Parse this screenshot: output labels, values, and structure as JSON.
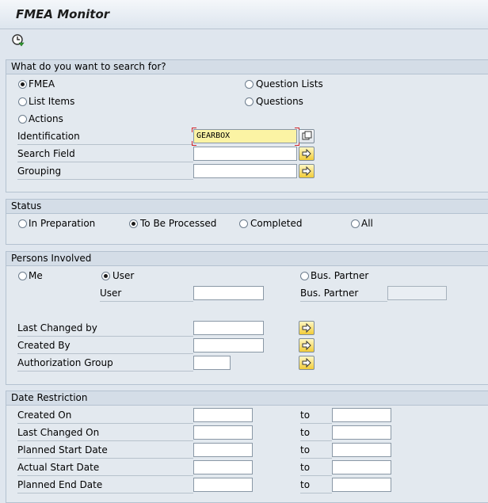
{
  "title": "FMEA Monitor",
  "toolbar": {
    "execute_icon": "execute-clock-icon"
  },
  "search": {
    "header": "What do you want to search for?",
    "options": {
      "fmea": "FMEA",
      "question_lists": "Question Lists",
      "list_items": "List Items",
      "questions": "Questions",
      "actions": "Actions"
    },
    "selected": "FMEA",
    "identification_label": "Identification",
    "identification_value": "GEARBOX",
    "search_field_label": "Search Field",
    "search_field_value": "",
    "grouping_label": "Grouping",
    "grouping_value": ""
  },
  "status": {
    "header": "Status",
    "options": {
      "in_preparation": "In Preparation",
      "to_be_processed": "To Be Processed",
      "completed": "Completed",
      "all": "All"
    },
    "selected": "To Be Processed"
  },
  "persons": {
    "header": "Persons Involved",
    "options": {
      "me": "Me",
      "user": "User",
      "bus_partner": "Bus. Partner"
    },
    "selected": "User",
    "user_label": "User",
    "user_value": "",
    "bus_partner_label": "Bus. Partner",
    "bus_partner_value": "",
    "last_changed_by_label": "Last Changed by",
    "created_by_label": "Created By",
    "authorization_group_label": "Authorization Group"
  },
  "dates": {
    "header": "Date Restriction",
    "to_label": "to",
    "rows": [
      {
        "label": "Created On",
        "from": "",
        "to": ""
      },
      {
        "label": "Last Changed On",
        "from": "",
        "to": ""
      },
      {
        "label": "Planned Start Date",
        "from": "",
        "to": ""
      },
      {
        "label": "Actual Start Date",
        "from": "",
        "to": ""
      },
      {
        "label": "Planned End Date",
        "from": "",
        "to": ""
      }
    ]
  },
  "colors": {
    "required_field": "#fbf3a4",
    "button": "#f2cc38",
    "group_header": "#d4dde7"
  }
}
